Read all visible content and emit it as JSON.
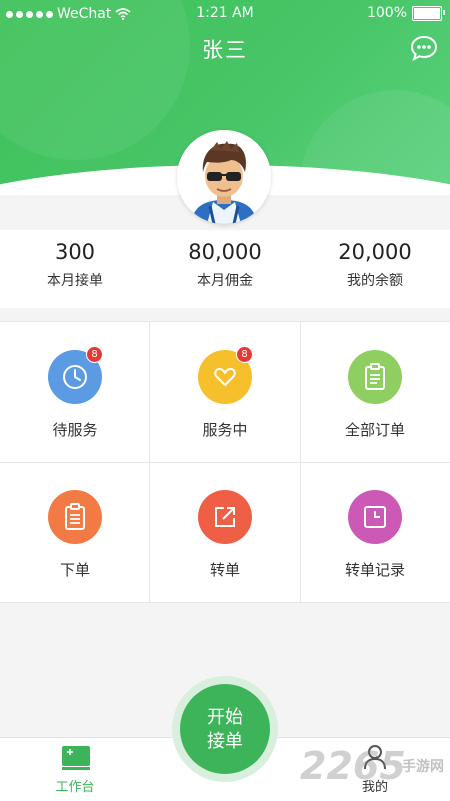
{
  "status_bar": {
    "carrier": "WeChat",
    "time": "1:21 AM",
    "battery": "100%"
  },
  "header": {
    "title": "张三"
  },
  "stats": [
    {
      "value": "300",
      "label": "本月接单"
    },
    {
      "value": "80,000",
      "label": "本月佣金"
    },
    {
      "value": "20,000",
      "label": "我的余额"
    }
  ],
  "grid": [
    {
      "label": "待服务",
      "icon": "clock-icon",
      "color": "#5b9be3",
      "badge": "8"
    },
    {
      "label": "服务中",
      "icon": "heart-icon",
      "color": "#f5c02b",
      "badge": "8"
    },
    {
      "label": "全部订单",
      "icon": "clipboard-icon",
      "color": "#8fcf62"
    },
    {
      "label": "下单",
      "icon": "order-form-icon",
      "color": "#f27a44"
    },
    {
      "label": "转单",
      "icon": "share-out-icon",
      "color": "#ef5f45"
    },
    {
      "label": "转单记录",
      "icon": "record-clock-icon",
      "color": "#cc59b6"
    }
  ],
  "start_button": {
    "line1": "开始",
    "line2": "接单"
  },
  "tabs": [
    {
      "label": "工作台",
      "icon": "workbench-icon",
      "active_color": "#3db45a"
    },
    {
      "label": "我的",
      "icon": "user-icon"
    }
  ],
  "watermark": {
    "number": "2265",
    "text": "手游网"
  }
}
